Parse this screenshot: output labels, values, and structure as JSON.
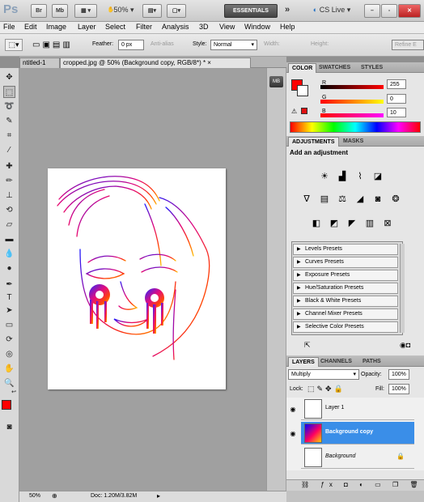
{
  "app": {
    "logo": "Ps",
    "bridge": "Br",
    "minibridge": "Mb",
    "zoom": "50%",
    "workspace": "ESSENTIALS",
    "expand": "»",
    "cslive": "CS Live"
  },
  "menu": [
    "File",
    "Edit",
    "Image",
    "Layer",
    "Select",
    "Filter",
    "Analysis",
    "3D",
    "View",
    "Window",
    "Help"
  ],
  "options": {
    "feather_label": "Feather:",
    "feather_value": "0 px",
    "antialias": "Anti-alias",
    "style_label": "Style:",
    "style_value": "Normal",
    "width_label": "Width:",
    "height_label": "Height:",
    "refine": "Refine E"
  },
  "tabs": {
    "inactive": "ntitled-1",
    "active": "cropped.jpg @ 50% (Background copy, RGB/8*) *",
    "close": "×"
  },
  "status": {
    "zoom": "50%",
    "doc": "Doc: 1.20M/3.82M"
  },
  "color_panel": {
    "tabs": [
      "COLOR",
      "SWATCHES",
      "STYLES"
    ],
    "r_label": "R",
    "g_label": "G",
    "b_label": "B",
    "r": "255",
    "g": "0",
    "b": "10",
    "fg": "#ff0000"
  },
  "adjust_panel": {
    "tabs": [
      "ADJUSTMENTS",
      "MASKS"
    ],
    "heading": "Add an adjustment",
    "presets": [
      "Levels Presets",
      "Curves Presets",
      "Exposure Presets",
      "Hue/Saturation Presets",
      "Black & White Presets",
      "Channel Mixer Presets",
      "Selective Color Presets"
    ]
  },
  "layers_panel": {
    "tabs": [
      "LAYERS",
      "CHANNELS",
      "PATHS"
    ],
    "blend": "Multiply",
    "opacity_label": "Opacity:",
    "opacity": "100%",
    "lock_label": "Lock:",
    "fill_label": "Fill:",
    "fill": "100%",
    "layers": [
      "Layer 1",
      "Background copy",
      "Background"
    ]
  }
}
